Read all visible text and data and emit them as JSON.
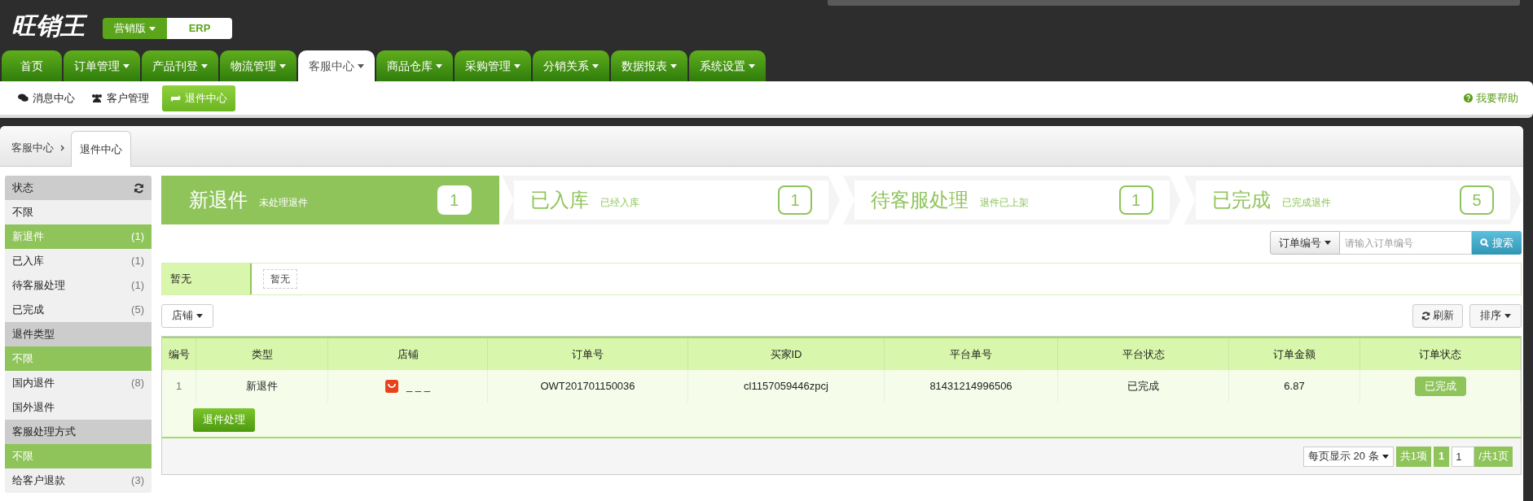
{
  "logo": "旺销王",
  "edition": {
    "label": "营销版",
    "product": "ERP"
  },
  "nav": [
    {
      "label": "首页",
      "dropdown": false,
      "selected": false
    },
    {
      "label": "订单管理",
      "dropdown": true,
      "selected": false
    },
    {
      "label": "产品刊登",
      "dropdown": true,
      "selected": false
    },
    {
      "label": "物流管理",
      "dropdown": true,
      "selected": false
    },
    {
      "label": "客服中心",
      "dropdown": true,
      "selected": true
    },
    {
      "label": "商品仓库",
      "dropdown": true,
      "selected": false
    },
    {
      "label": "采购管理",
      "dropdown": true,
      "selected": false
    },
    {
      "label": "分销关系",
      "dropdown": true,
      "selected": false
    },
    {
      "label": "数据报表",
      "dropdown": true,
      "selected": false
    },
    {
      "label": "系统设置",
      "dropdown": true,
      "selected": false
    }
  ],
  "subnav": [
    {
      "label": "消息中心",
      "selected": false
    },
    {
      "label": "客户管理",
      "selected": false
    },
    {
      "label": "退件中心",
      "selected": true
    }
  ],
  "help": "我要帮助",
  "breadcrumb": {
    "parent": "客服中心",
    "current": "退件中心"
  },
  "sidebar": [
    {
      "title": "状态",
      "refresh": true,
      "items": [
        {
          "label": "不限",
          "selected": false
        },
        {
          "label": "新退件",
          "count": "(1)",
          "selected": true
        },
        {
          "label": "已入库",
          "count": "(1)",
          "selected": false
        },
        {
          "label": "待客服处理",
          "count": "(1)",
          "selected": false
        },
        {
          "label": "已完成",
          "count": "(5)",
          "selected": false
        }
      ]
    },
    {
      "title": "退件类型",
      "refresh": false,
      "items": [
        {
          "label": "不限",
          "selected": true
        },
        {
          "label": "国内退件",
          "count": "(8)",
          "selected": false
        },
        {
          "label": "国外退件",
          "selected": false
        }
      ]
    },
    {
      "title": "客服处理方式",
      "refresh": false,
      "items": [
        {
          "label": "不限",
          "selected": true
        },
        {
          "label": "给客户退款",
          "count": "(3)",
          "selected": false
        }
      ]
    }
  ],
  "steps": [
    {
      "title": "新退件",
      "subtitle": "未处理退件",
      "count": "1",
      "selected": true
    },
    {
      "title": "已入库",
      "subtitle": "已经入库",
      "count": "1",
      "selected": false
    },
    {
      "title": "待客服处理",
      "subtitle": "退件已上架",
      "count": "1",
      "selected": false
    },
    {
      "title": "已完成",
      "subtitle": "已完成退件",
      "count": "5",
      "selected": false
    }
  ],
  "search": {
    "field": "订单编号",
    "placeholder": "请输入订单编号",
    "button": "搜索"
  },
  "filter": {
    "label": "暂无",
    "tag": "暂无"
  },
  "shop_button": "店铺",
  "refresh_button": "刷新",
  "sort_button": "排序",
  "table": {
    "columns": [
      "编号",
      "类型",
      "店铺",
      "订单号",
      "买家ID",
      "平台单号",
      "平台状态",
      "订单金额",
      "订单状态"
    ],
    "rows": [
      {
        "no": "1",
        "type": "新退件",
        "shop": "_ _ _",
        "order": "OWT201701150036",
        "buyer": "cl1157059446zpcj",
        "platform_no": "81431214996506",
        "platform_status": "已完成",
        "amount": "6.87",
        "status": "已完成",
        "action": "退件处理"
      }
    ]
  },
  "pagination": {
    "page_size": "每页显示 20 条",
    "total": "共1项",
    "page": "1",
    "input": "1",
    "pages": "/共1页"
  }
}
